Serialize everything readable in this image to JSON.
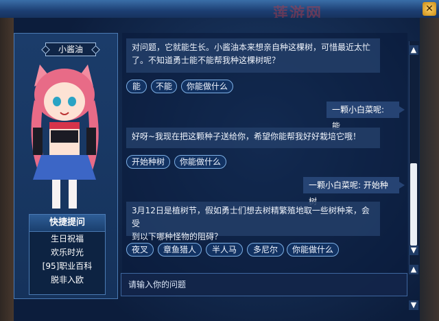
{
  "watermark": "莲游网",
  "close_label": "✕",
  "npc": {
    "name": "小酱油"
  },
  "quick": {
    "title": "快捷提问",
    "items": [
      "生日祝福",
      "欢乐时光",
      "[95]职业百科",
      "脱非入欧"
    ]
  },
  "chat": {
    "msg1_line1": "对问题，它就能生长。小酱油本来想亲自种这棵树，可惜最近太忙",
    "msg1_line2": "了。不知道勇士能不能帮我种这棵树呢？",
    "opts1": [
      "能",
      "不能",
      "你能做什么"
    ],
    "user1": "一颗小白菜呢: 能",
    "msg2": "好呀~我现在把这颗种子送给你，希望你能帮我好好栽培它哦！",
    "opts2": [
      "开始种树",
      "你能做什么"
    ],
    "user2": "一颗小白菜呢: 开始种树",
    "msg3_line1": "3月12日是植树节，假如勇士们想去树精繁殖地取一些树种来，会受",
    "msg3_line2": "到以下哪种怪物的阻碍？",
    "opts3": [
      "夜叉",
      "章鱼猎人",
      "半人马",
      "多尼尔",
      "你能做什么"
    ]
  },
  "input": {
    "placeholder": "请输入你的问题"
  },
  "scroll": {
    "up": "▲",
    "down": "▼"
  },
  "colors": {
    "accent": "#7fb1e6",
    "panel": "#1b3c6a"
  }
}
